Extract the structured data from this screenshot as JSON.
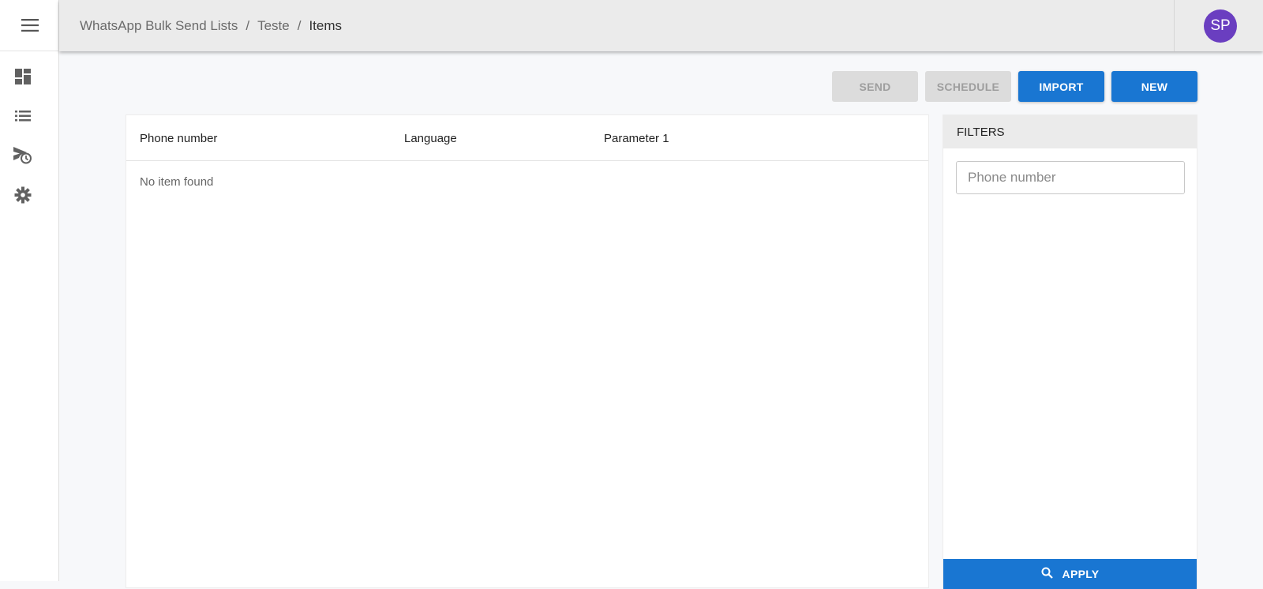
{
  "sidebar": {
    "menu_icon": "hamburger-menu-icon",
    "items": [
      {
        "icon": "dashboard-icon"
      },
      {
        "icon": "list-icon"
      },
      {
        "icon": "send-schedule-icon"
      },
      {
        "icon": "gear-icon"
      }
    ]
  },
  "header": {
    "breadcrumb": [
      "WhatsApp Bulk Send Lists",
      "Teste",
      "Items"
    ],
    "separator": "/",
    "avatar_initials": "SP"
  },
  "toolbar": {
    "send_label": "SEND",
    "schedule_label": "SCHEDULE",
    "import_label": "IMPORT",
    "new_label": "NEW"
  },
  "table": {
    "columns": [
      "Phone number",
      "Language",
      "Parameter 1"
    ],
    "rows": [],
    "empty_text": "No item found"
  },
  "filters": {
    "title": "FILTERS",
    "phone_placeholder": "Phone number",
    "phone_value": "",
    "apply_label": "APPLY",
    "apply_icon": "search-icon"
  },
  "colors": {
    "primary": "#1976d2",
    "avatar": "#6a3ec0",
    "disabled_bg": "#dcdcdc",
    "disabled_text": "#9e9e9e"
  }
}
